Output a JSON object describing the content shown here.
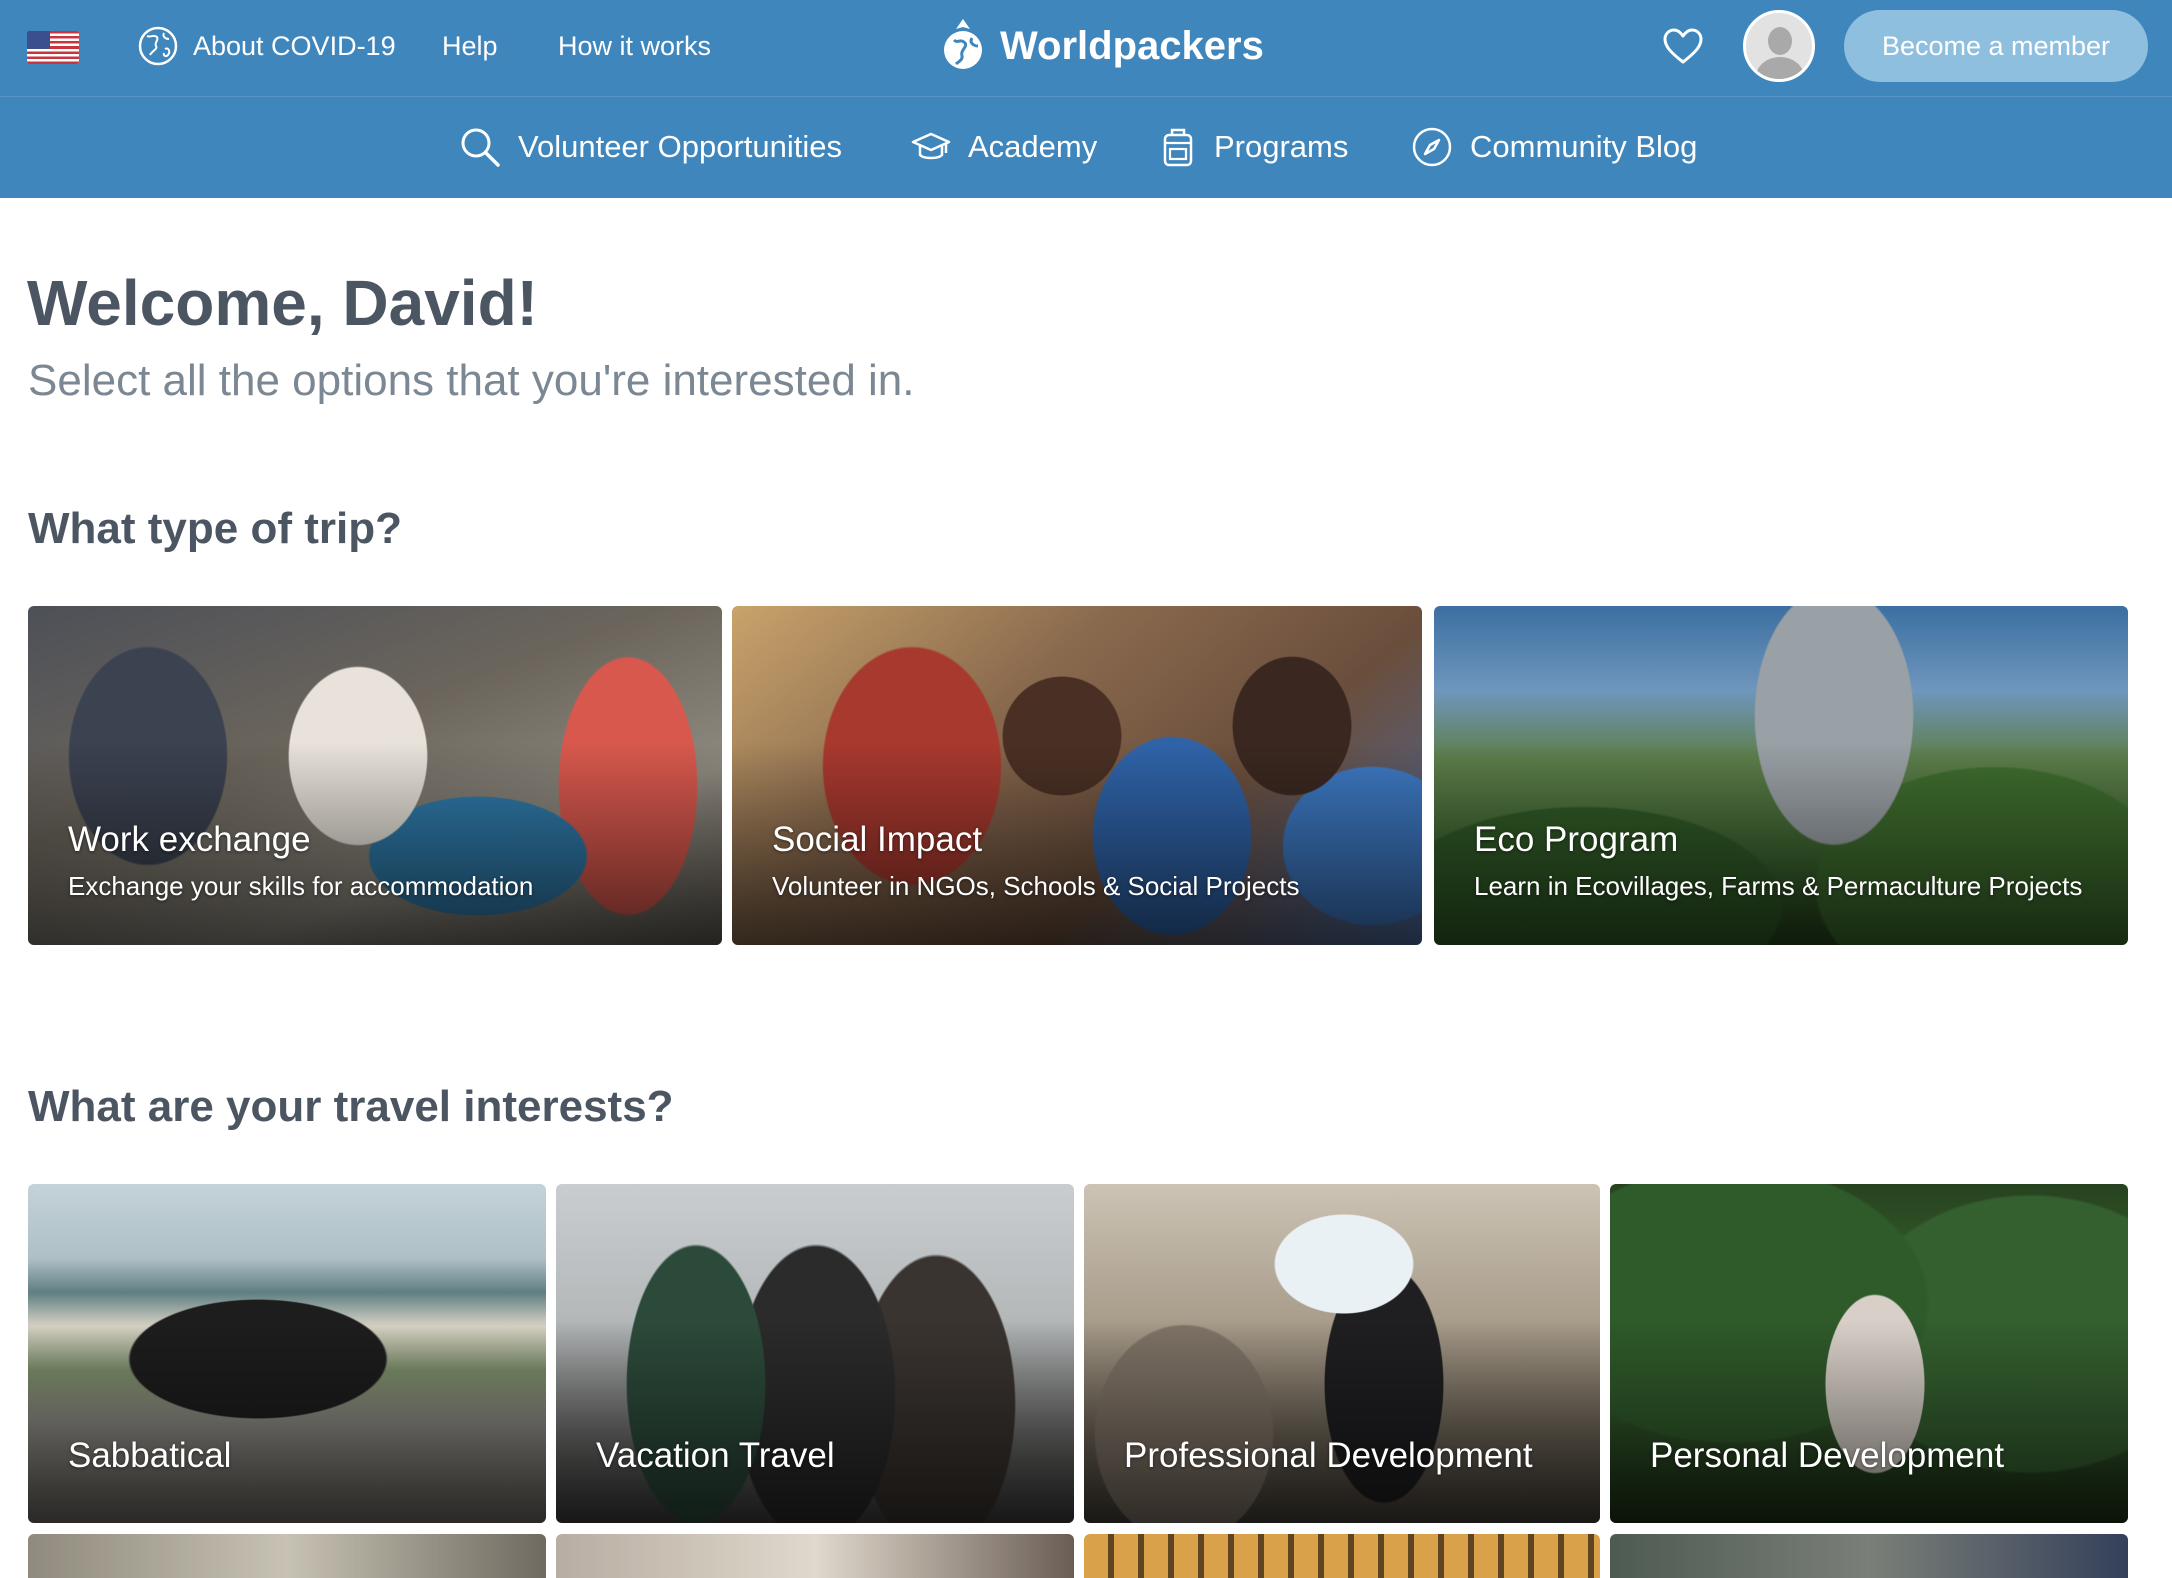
{
  "header": {
    "covid_label": "About COVID-19",
    "help_label": "Help",
    "how_label": "How it works",
    "brand": "Worldpackers",
    "member_button": "Become a member"
  },
  "nav": {
    "items": [
      {
        "label": "Volunteer Opportunities",
        "icon": "search-icon"
      },
      {
        "label": "Academy",
        "icon": "graduation-cap-icon"
      },
      {
        "label": "Programs",
        "icon": "backpack-icon"
      },
      {
        "label": "Community Blog",
        "icon": "compass-icon"
      }
    ]
  },
  "main": {
    "welcome": "Welcome, David!",
    "subtitle": "Select all the options that you're interested in.",
    "trip_section_title": "What type of trip?",
    "trip_options": [
      {
        "title": "Work exchange",
        "description": "Exchange your skills for accommodation"
      },
      {
        "title": "Social Impact",
        "description": "Volunteer in NGOs, Schools & Social Projects"
      },
      {
        "title": "Eco Program",
        "description": "Learn in Ecovillages, Farms & Permaculture Projects"
      }
    ],
    "interests_section_title": "What are your travel interests?",
    "interests": [
      {
        "title": "Sabbatical"
      },
      {
        "title": "Vacation Travel"
      },
      {
        "title": "Professional Development"
      },
      {
        "title": "Personal Development"
      }
    ]
  },
  "colors": {
    "header_bg": "#3f86bd",
    "member_button_bg": "#8fbfde",
    "heading_text": "#4c5663",
    "subtitle_text": "#7b8793"
  }
}
